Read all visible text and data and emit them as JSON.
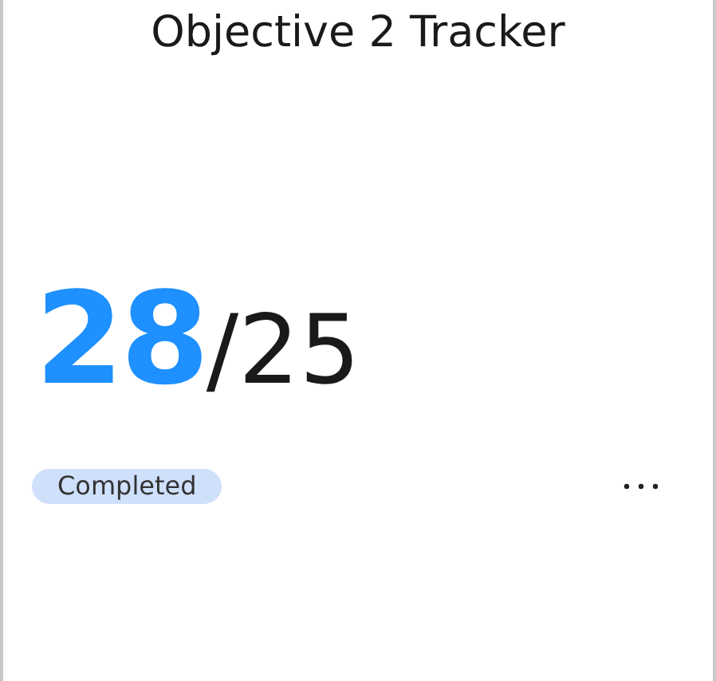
{
  "card": {
    "title": "Objective 2 Tracker",
    "value": "28",
    "target": "/25",
    "status": "Completed"
  }
}
